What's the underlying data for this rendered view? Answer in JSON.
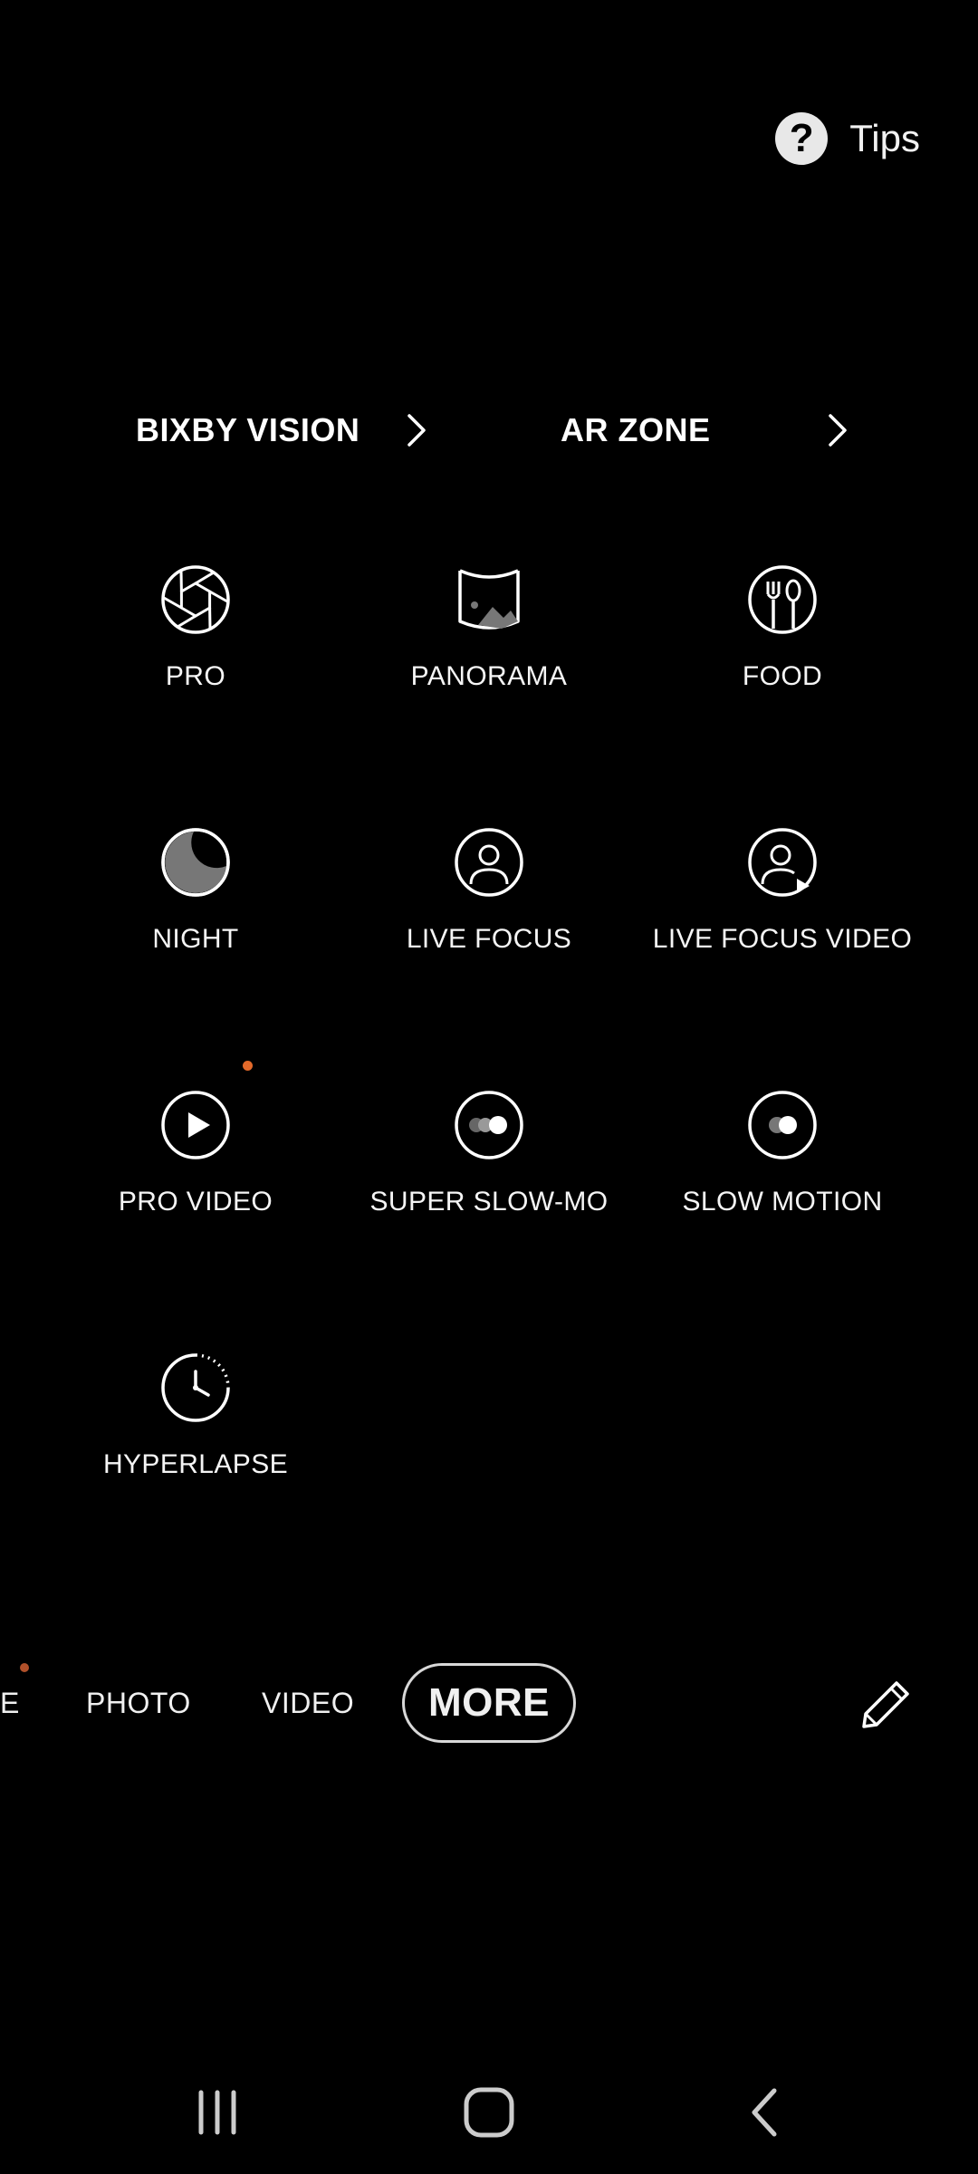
{
  "tips": {
    "label": "Tips",
    "icon": "question-icon"
  },
  "shortcuts": [
    {
      "label": "BIXBY VISION",
      "icon": "chevron-right-icon"
    },
    {
      "label": "AR ZONE",
      "icon": "chevron-right-icon"
    }
  ],
  "modes": [
    {
      "label": "PRO",
      "icon": "aperture-icon"
    },
    {
      "label": "PANORAMA",
      "icon": "panorama-icon"
    },
    {
      "label": "FOOD",
      "icon": "fork-spoon-icon"
    },
    {
      "label": "NIGHT",
      "icon": "moon-icon"
    },
    {
      "label": "LIVE FOCUS",
      "icon": "person-icon"
    },
    {
      "label": "LIVE FOCUS VIDEO",
      "icon": "person-video-icon"
    },
    {
      "label": "PRO VIDEO",
      "icon": "play-icon"
    },
    {
      "label": "SUPER SLOW-MO",
      "icon": "super-slow-icon"
    },
    {
      "label": "SLOW MOTION",
      "icon": "slow-motion-icon"
    },
    {
      "label": "HYPERLAPSE",
      "icon": "timer-clock-icon"
    }
  ],
  "mode_bar": {
    "tabs": [
      {
        "label": "E"
      },
      {
        "label": "PHOTO"
      },
      {
        "label": "VIDEO"
      },
      {
        "label": "MORE",
        "selected": true
      }
    ],
    "edit_icon": "pencil-icon"
  },
  "system_nav": {
    "recents_icon": "recents-icon",
    "home_icon": "home-icon",
    "back_icon": "back-icon"
  },
  "colors": {
    "background": "#000000",
    "text": "#ffffff",
    "new_badge": "#e3692a"
  }
}
